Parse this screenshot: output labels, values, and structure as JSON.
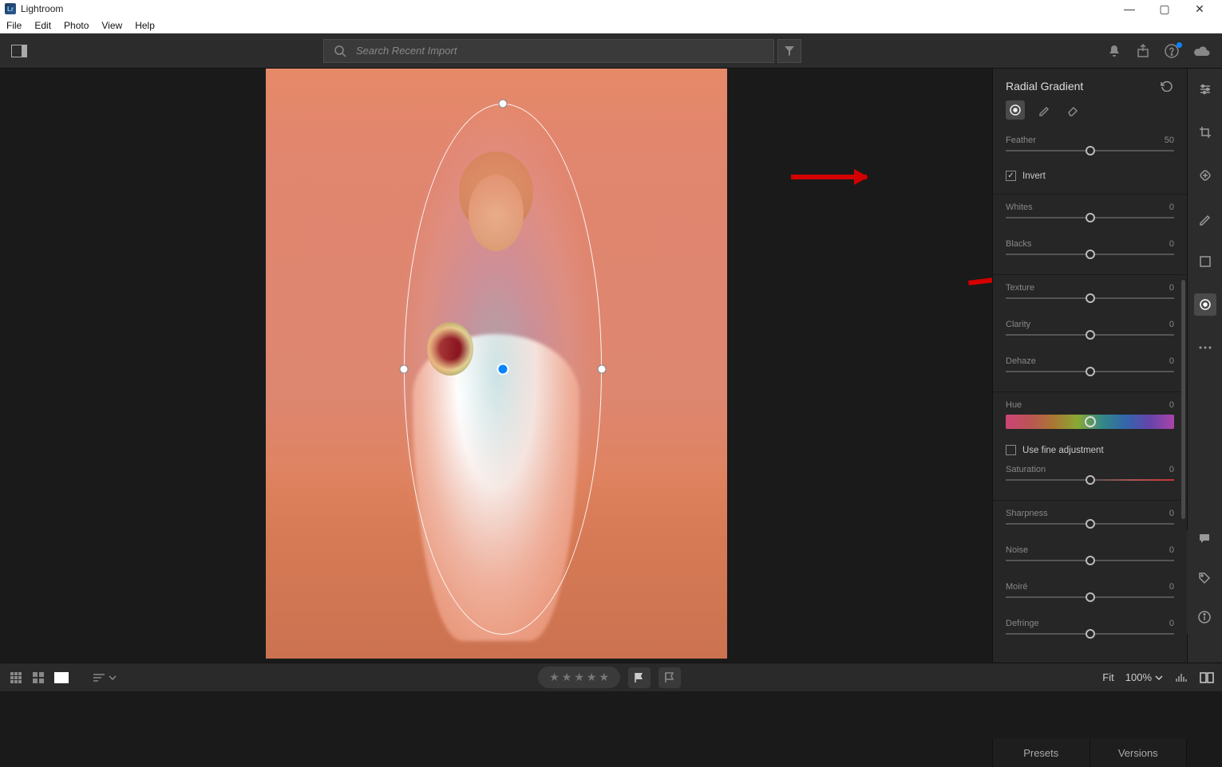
{
  "titlebar": {
    "app_name": "Lightroom"
  },
  "menubar": {
    "items": [
      "File",
      "Edit",
      "Photo",
      "View",
      "Help"
    ]
  },
  "topbar": {
    "search_placeholder": "Search Recent Import"
  },
  "panel": {
    "title": "Radial Gradient",
    "feather": {
      "label": "Feather",
      "value": "50",
      "pos": 50
    },
    "invert": {
      "label": "Invert",
      "checked": true
    },
    "sliders": [
      {
        "label": "Whites",
        "value": "0",
        "pos": 50
      },
      {
        "label": "Blacks",
        "value": "0",
        "pos": 50
      },
      {
        "label": "Texture",
        "value": "0",
        "pos": 50
      },
      {
        "label": "Clarity",
        "value": "0",
        "pos": 50
      },
      {
        "label": "Dehaze",
        "value": "0",
        "pos": 50
      }
    ],
    "hue": {
      "label": "Hue",
      "value": "0",
      "pos": 50
    },
    "fine_adj": {
      "label": "Use fine adjustment",
      "checked": false
    },
    "saturation": {
      "label": "Saturation",
      "value": "0",
      "pos": 50
    },
    "sliders2": [
      {
        "label": "Sharpness",
        "value": "0",
        "pos": 50
      },
      {
        "label": "Noise",
        "value": "0",
        "pos": 50
      },
      {
        "label": "Moiré",
        "value": "0",
        "pos": 50
      },
      {
        "label": "Defringe",
        "value": "0",
        "pos": 50
      }
    ]
  },
  "bottombar": {
    "fit_label": "Fit",
    "zoom": "100%"
  },
  "paneltabs": {
    "presets": "Presets",
    "versions": "Versions"
  }
}
